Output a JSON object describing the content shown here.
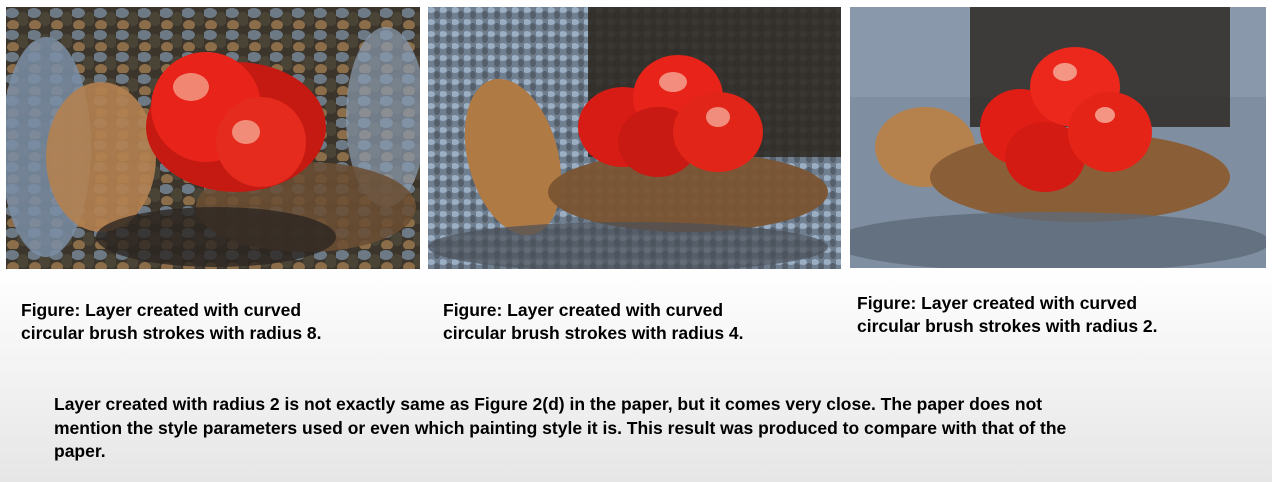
{
  "figures": [
    {
      "image_name": "painting-radius-8",
      "caption_line1": "Figure: Layer created with curved",
      "caption_line2": "circular brush strokes with radius 8."
    },
    {
      "image_name": "painting-radius-4",
      "caption_line1": "Figure: Layer created with curved",
      "caption_line2": "circular brush strokes with radius 4."
    },
    {
      "image_name": "painting-radius-2",
      "caption_line1": "Figure: Layer created with curved",
      "caption_line2": "circular brush strokes with radius 2."
    }
  ],
  "note": {
    "line1": "Layer created with radius 2 is not exactly same as Figure 2(d) in the paper, but it comes very close. The paper does not",
    "line2": "mention the style parameters used or even which painting style it is. This result was produced to compare with that of the",
    "line3": "paper."
  },
  "colors": {
    "background_top": "#ffffff",
    "background_bottom": "#e6e6e6",
    "fruit_red": "#e81a14",
    "hand_tan": "#b07a45",
    "cloth_blue": "#7f96b4",
    "shadow_dark": "#2a2420"
  }
}
